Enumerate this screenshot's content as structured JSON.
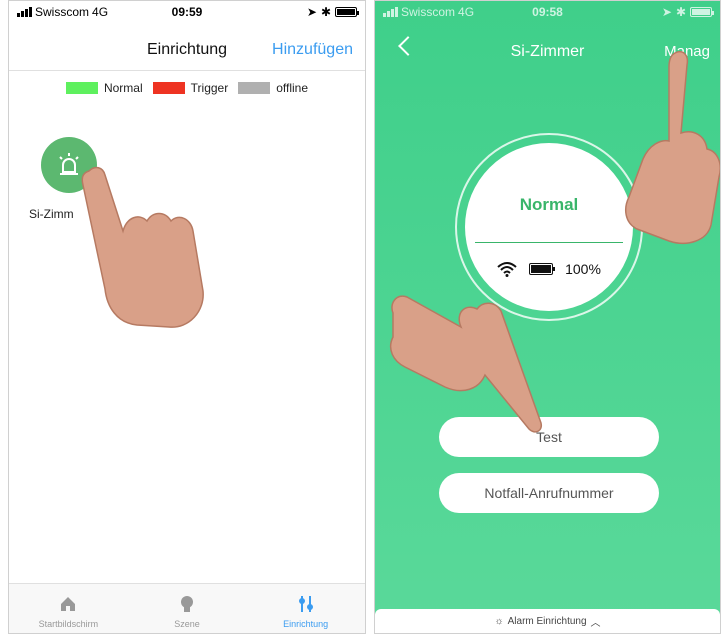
{
  "left_phone": {
    "status": {
      "carrier": "Swisscom",
      "network": "4G",
      "time": "09:59"
    },
    "nav": {
      "title": "Einrichtung",
      "add": "Hinzufügen"
    },
    "legend": [
      {
        "label": "Normal",
        "color": "#5ef05e"
      },
      {
        "label": "Trigger",
        "color": "#ee3322"
      },
      {
        "label": "offline",
        "color": "#b0b0b0"
      }
    ],
    "device": {
      "label": "Si-Zimm",
      "icon": "siren-icon",
      "color": "#5cb870"
    },
    "tabs": [
      {
        "label": "Startbildschirm",
        "icon": "home-icon"
      },
      {
        "label": "Szene",
        "icon": "bulb-icon"
      },
      {
        "label": "Einrichtung",
        "icon": "sliders-icon"
      }
    ]
  },
  "right_phone": {
    "status": {
      "carrier": "Swisscom",
      "network": "4G",
      "time": "09:58"
    },
    "nav": {
      "title": "Si-Zimmer",
      "manage": "Manag"
    },
    "device_status": "Normal",
    "battery": "100%",
    "buttons": {
      "test": "Test",
      "notfall": "Notfall-Anrufnummer"
    },
    "bottom": "Alarm Einrichtung",
    "accent": "#3fcf8a"
  }
}
